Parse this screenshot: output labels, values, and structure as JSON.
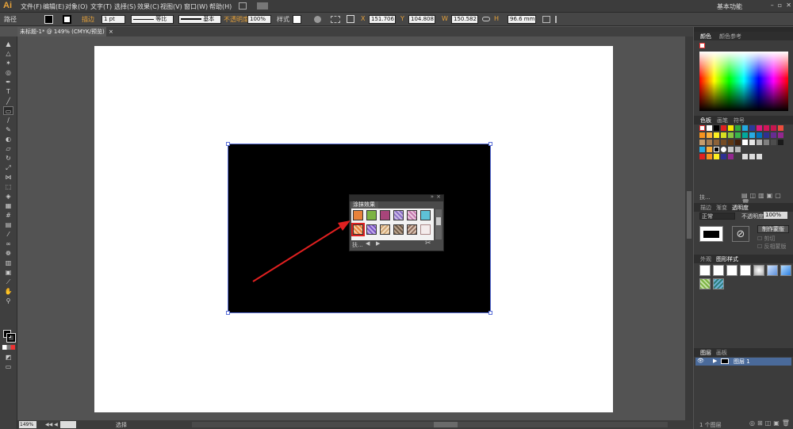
{
  "app": {
    "logo": "Ai",
    "menu": [
      "文件(F)",
      "编辑(E)",
      "对象(O)",
      "文字(T)",
      "选择(S)",
      "效果(C)",
      "视图(V)",
      "窗口(W)",
      "帮助(H)"
    ],
    "workspace": "基本功能"
  },
  "control": {
    "object_type": "路径",
    "stroke_label": "描边",
    "stroke_weight": "1 pt",
    "profile": "等比",
    "brush": "基本",
    "opacity_label": "不透明度",
    "opacity_value": "100%",
    "style_label": "样式",
    "x_value": "151.706",
    "y_value": "104.808",
    "w_value": "150.582",
    "h_value": "96.6 mm"
  },
  "document": {
    "tab_title": "未标题-1* @ 149% (CMYK/预览)",
    "zoom": "149%",
    "status": "选择"
  },
  "scribble_panel": {
    "title": "涂抹效果",
    "footer_label": "扶..."
  },
  "panels": {
    "color_tabs": [
      "颜色",
      "颜色参考"
    ],
    "swatch_tabs": [
      "色板",
      "画笔",
      "符号"
    ],
    "swatch_footer": "扶...",
    "stroke_tabs": [
      "描边",
      "渐变",
      "透明度"
    ],
    "blend_mode": "正常",
    "opacity_label": "不透明度",
    "opacity_value": "100%",
    "make_mask": "制作蒙版",
    "clip": "剪切",
    "invert": "反相蒙版",
    "appearance_tabs": [
      "外观",
      "图形样式"
    ],
    "layer_tabs": [
      "图层",
      "画板"
    ],
    "layer_name": "图层 1",
    "layer_count": "1 个图层"
  },
  "colors": {
    "accent": "#e8a33a",
    "highlight_box": "#e02020",
    "arrow": "#e02020"
  }
}
